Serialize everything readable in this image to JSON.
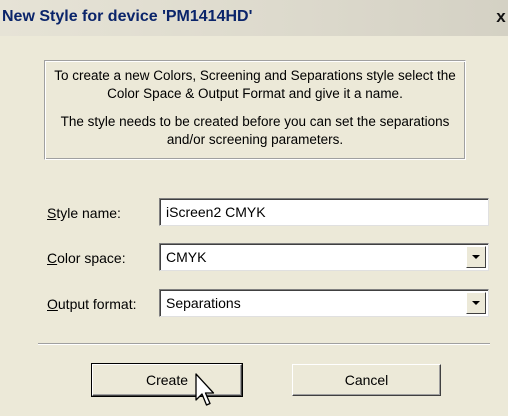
{
  "window": {
    "title": "New Style for device 'PM1414HD'",
    "close_label": "x"
  },
  "info": {
    "paragraph1": "To create a new Colors, Screening and Separations style select the Color Space & Output Format and give it a name.",
    "paragraph2": "The style needs to be created before you can set the separations and/or  screening parameters."
  },
  "form": {
    "style_name": {
      "label_accel": "S",
      "label_rest": "tyle name:",
      "value": "iScreen2 CMYK"
    },
    "color_space": {
      "label_accel": "C",
      "label_rest": "olor space:",
      "value": "CMYK"
    },
    "output_format": {
      "label_accel": "O",
      "label_rest": "utput format:",
      "value": "Separations"
    }
  },
  "buttons": {
    "create": "Create",
    "cancel": "Cancel"
  },
  "icons": {
    "close": "close-icon",
    "dropdown": "chevron-down-icon",
    "cursor": "mouse-pointer-icon"
  },
  "colors": {
    "title_text": "#0a246a",
    "dialog_bg": "#ece9d8"
  }
}
